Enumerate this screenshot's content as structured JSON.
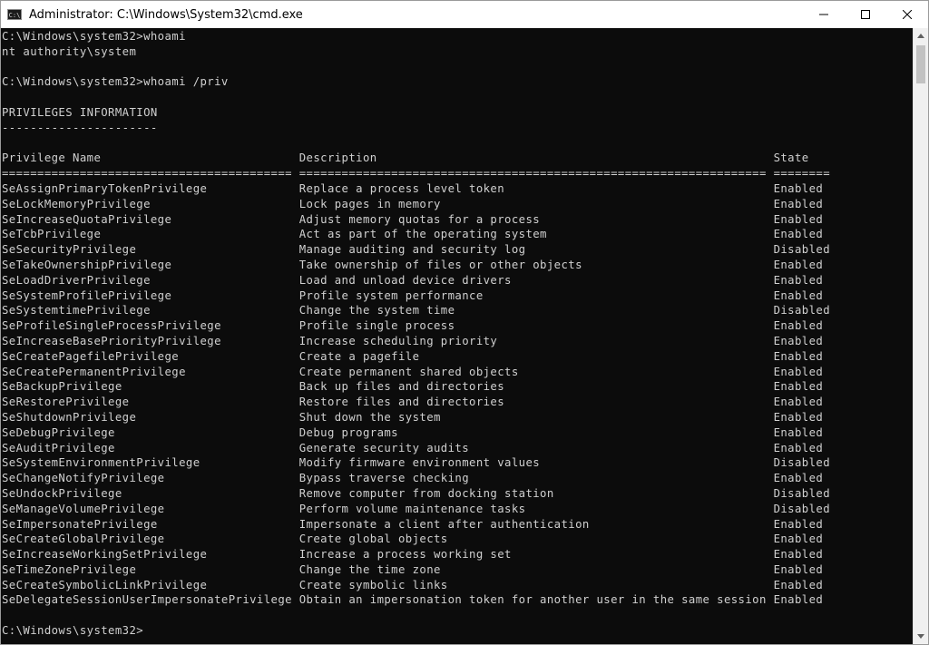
{
  "window": {
    "title": "Administrator: C:\\Windows\\System32\\cmd.exe",
    "app_icon_text": "C:\\",
    "icons": {
      "app": "cmd-app-icon",
      "minimize": "minimize-icon",
      "maximize": "maximize-icon",
      "close": "close-icon"
    }
  },
  "console": {
    "lines": [
      "C:\\Windows\\system32>whoami",
      "nt authority\\system",
      "",
      "C:\\Windows\\system32>whoami /priv",
      "",
      "PRIVILEGES INFORMATION",
      "----------------------",
      "",
      "Privilege Name                            Description                                                        State",
      "========================================= ================================================================== ========",
      "SeAssignPrimaryTokenPrivilege             Replace a process level token                                      Enabled",
      "SeLockMemoryPrivilege                     Lock pages in memory                                               Enabled",
      "SeIncreaseQuotaPrivilege                  Adjust memory quotas for a process                                 Enabled",
      "SeTcbPrivilege                            Act as part of the operating system                                Enabled",
      "SeSecurityPrivilege                       Manage auditing and security log                                   Disabled",
      "SeTakeOwnershipPrivilege                  Take ownership of files or other objects                           Enabled",
      "SeLoadDriverPrivilege                     Load and unload device drivers                                     Enabled",
      "SeSystemProfilePrivilege                  Profile system performance                                         Enabled",
      "SeSystemtimePrivilege                     Change the system time                                             Disabled",
      "SeProfileSingleProcessPrivilege           Profile single process                                             Enabled",
      "SeIncreaseBasePriorityPrivilege           Increase scheduling priority                                       Enabled",
      "SeCreatePagefilePrivilege                 Create a pagefile                                                  Enabled",
      "SeCreatePermanentPrivilege                Create permanent shared objects                                    Enabled",
      "SeBackupPrivilege                         Back up files and directories                                      Enabled",
      "SeRestorePrivilege                        Restore files and directories                                      Enabled",
      "SeShutdownPrivilege                       Shut down the system                                               Enabled",
      "SeDebugPrivilege                          Debug programs                                                     Enabled",
      "SeAuditPrivilege                          Generate security audits                                           Enabled",
      "SeSystemEnvironmentPrivilege              Modify firmware environment values                                 Disabled",
      "SeChangeNotifyPrivilege                   Bypass traverse checking                                           Enabled",
      "SeUndockPrivilege                         Remove computer from docking station                               Disabled",
      "SeManageVolumePrivilege                   Perform volume maintenance tasks                                   Disabled",
      "SeImpersonatePrivilege                    Impersonate a client after authentication                          Enabled",
      "SeCreateGlobalPrivilege                   Create global objects                                              Enabled",
      "SeIncreaseWorkingSetPrivilege             Increase a process working set                                     Enabled",
      "SeTimeZonePrivilege                       Change the time zone                                               Enabled",
      "SeCreateSymbolicLinkPrivilege             Create symbolic links                                              Enabled",
      "SeDelegateSessionUserImpersonatePrivilege Obtain an impersonation token for another user in the same session Enabled",
      "",
      "C:\\Windows\\system32>"
    ]
  },
  "scrollbar": {
    "icons": {
      "up": "scroll-up-icon",
      "down": "scroll-down-icon"
    }
  }
}
